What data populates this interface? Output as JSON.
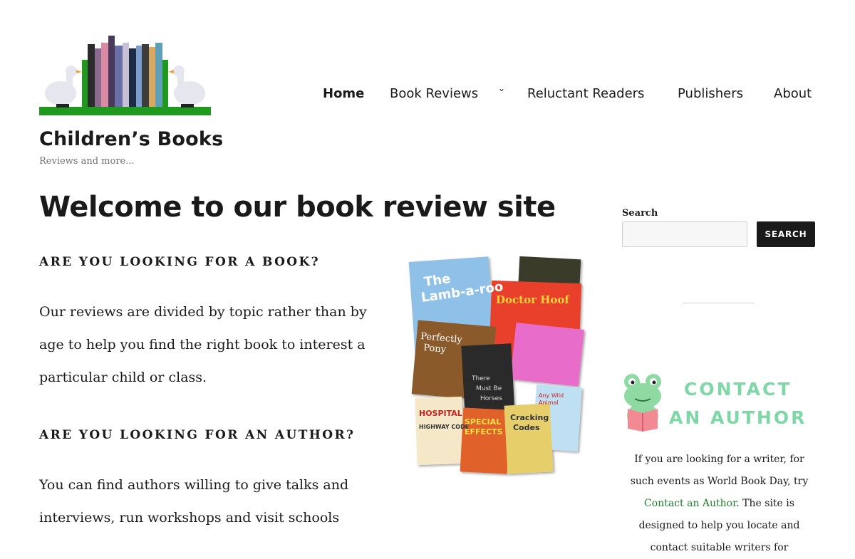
{
  "site": {
    "title": "Children’s Books",
    "tagline": "Reviews and more..."
  },
  "nav": {
    "items": [
      {
        "label": "Home",
        "active": true
      },
      {
        "label": "Book Reviews",
        "has_submenu": true
      },
      {
        "label": "Reluctant Readers"
      },
      {
        "label": "Publishers"
      },
      {
        "label": "About"
      }
    ],
    "submenu_icon": "chevron-down-icon"
  },
  "main": {
    "title": "Welcome to our book review site",
    "section_book": {
      "heading": "ARE YOU LOOKING FOR A BOOK?",
      "body": "Our reviews are divided by topic rather than by age to help you find the right book to interest a particular child or class."
    },
    "section_author": {
      "heading": "ARE YOU LOOKING FOR AN AUTHOR?",
      "body": "You can find authors willing to give talks and interviews, run workshops and visit schools"
    },
    "collage_covers": [
      "The Lamb-a-roo",
      "Doctor Hoof",
      "Perfectly Pony",
      "There Must Be Horses",
      "Hospital Highway Code",
      "Special Effects",
      "Cracking Codes",
      "Any Wild Animal Rescue"
    ]
  },
  "sidebar": {
    "search": {
      "label": "Search",
      "placeholder": "",
      "value": "",
      "button_label": "SEARCH"
    },
    "contact": {
      "line1": "CONTACT",
      "line2": "AN AUTHOR",
      "text_before": "If you are looking for a writer, for such events as World Book Day, try ",
      "link_text": "Contact an Author",
      "text_after": ". The site is designed to help you locate and contact suitable writers for"
    }
  },
  "colors": {
    "text": "#1a1a1a",
    "accent_green": "#1e7f2a",
    "contact_mint": "#7fd6a6",
    "button_bg": "#1a1a1a",
    "logo_green": "#1f9a1f"
  }
}
